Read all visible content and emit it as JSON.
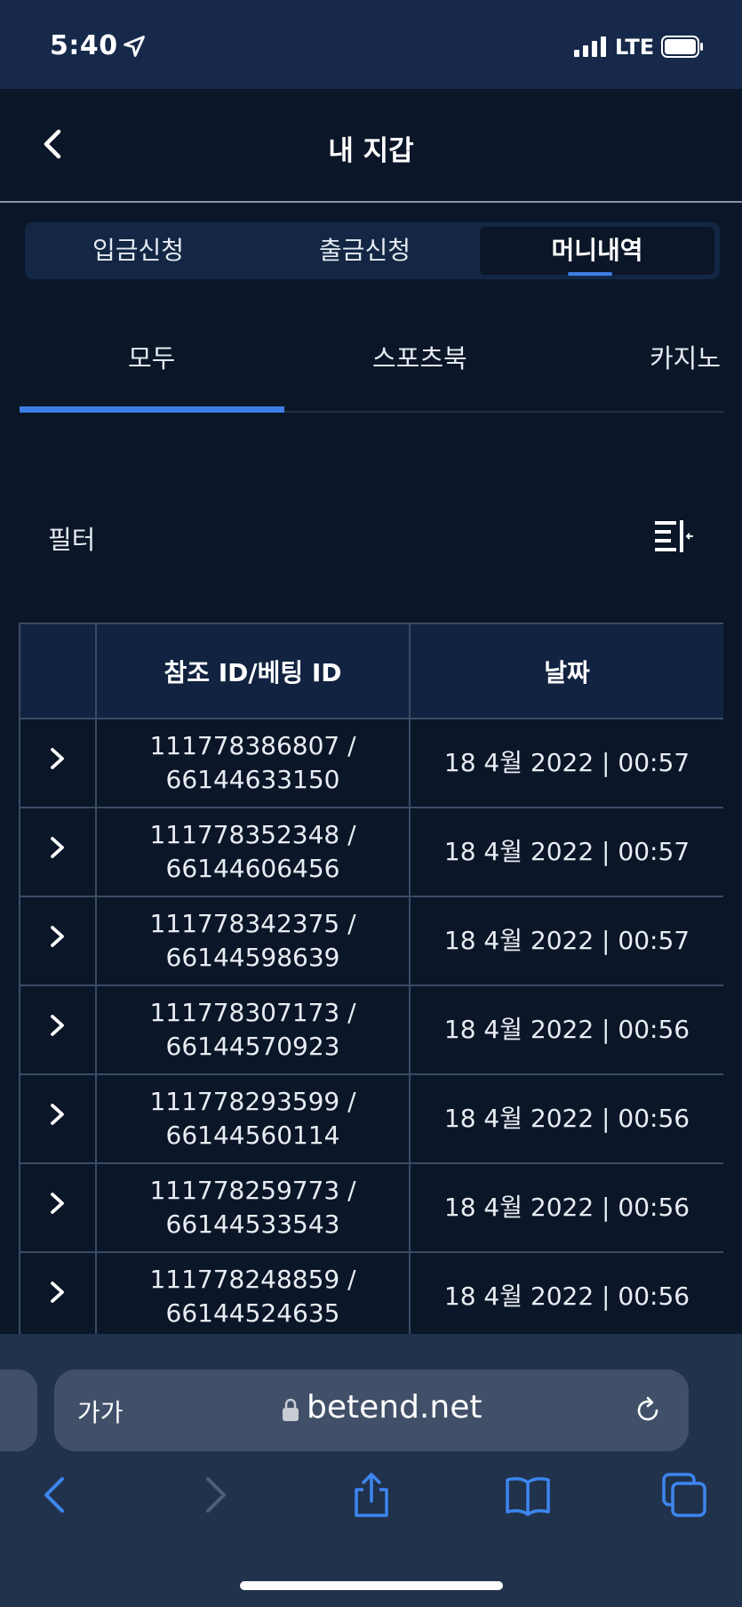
{
  "status": {
    "time": "5:40",
    "network": "LTE"
  },
  "header": {
    "title": "내 지갑"
  },
  "segments": [
    {
      "label": "입금신청"
    },
    {
      "label": "출금신청"
    },
    {
      "label": "머니내역"
    }
  ],
  "subtabs": [
    {
      "label": "모두"
    },
    {
      "label": "스포츠북"
    },
    {
      "label": "카지노"
    }
  ],
  "filter": {
    "label": "필터"
  },
  "table": {
    "headers": [
      "",
      "참조 ID/베팅 ID",
      "날짜"
    ],
    "rows": [
      {
        "ref": "111778386807 /",
        "bet": "66144633150",
        "date": "18 4월 2022 | 00:57"
      },
      {
        "ref": "111778352348 /",
        "bet": "66144606456",
        "date": "18 4월 2022 | 00:57"
      },
      {
        "ref": "111778342375 /",
        "bet": "66144598639",
        "date": "18 4월 2022 | 00:57"
      },
      {
        "ref": "111778307173 /",
        "bet": "66144570923",
        "date": "18 4월 2022 | 00:56"
      },
      {
        "ref": "111778293599 /",
        "bet": "66144560114",
        "date": "18 4월 2022 | 00:56"
      },
      {
        "ref": "111778259773 /",
        "bet": "66144533543",
        "date": "18 4월 2022 | 00:56"
      },
      {
        "ref": "111778248859 /",
        "bet": "66144524635",
        "date": "18 4월 2022 | 00:56"
      }
    ]
  },
  "browser": {
    "text_size": "가가",
    "url": "betend.net"
  },
  "colors": {
    "accent": "#3d7fe6",
    "background": "#0b1628",
    "header_cell": "#112340"
  }
}
